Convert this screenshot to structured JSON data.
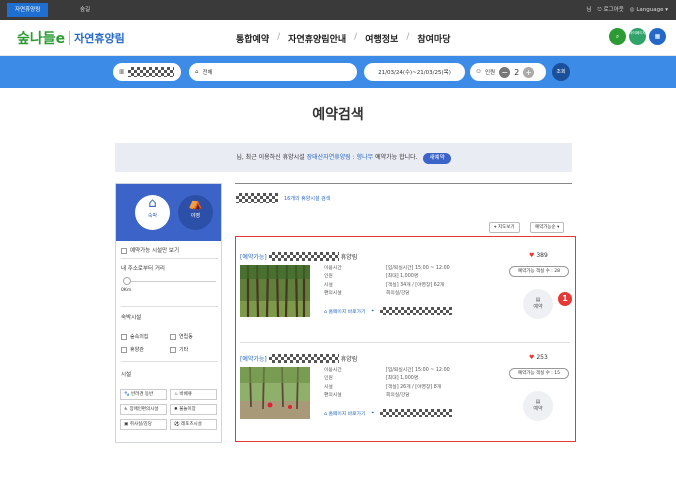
{
  "topbar": {
    "tab_active": "자연휴양림",
    "tab2": "숲길",
    "user": "님",
    "logout": "로그아웃",
    "language": "Language"
  },
  "header": {
    "brand_mark": "숲나들e",
    "brand_name": "자연휴양림",
    "nav": [
      "통합예약",
      "자연휴양림안내",
      "여행정보",
      "참여마당"
    ],
    "icon_labels": [
      "",
      "마이페이지",
      ""
    ]
  },
  "search": {
    "region": "전체",
    "dates": "21/03/24(수)~21/03/25(목)",
    "people_label": "인원",
    "people_count": "2",
    "go": "조회"
  },
  "page_title": "예약검색",
  "notice": {
    "prefix": "님, 최근 이용하신 휴양시설 ",
    "facility": "장태산자연휴양림 : 향나무",
    "suffix": " 예약가능 합니다.",
    "button": "새예약"
  },
  "left": {
    "type_lodging": "숙박",
    "type_camping": "야영",
    "only_available": "예약가능 시설만 보기",
    "distance_label": "내 주소로부터 거리",
    "distance_value": "0Km",
    "lodging_title": "숙박시설",
    "lodging_options": [
      "숲속의집",
      "연립동",
      "휴양관",
      "기타"
    ],
    "facility_title": "시설",
    "facility_options": [
      "반려견 동반",
      "바베큐",
      "장애인편의시설",
      "불놀이장",
      "취사실/강당",
      "레포츠시설"
    ]
  },
  "results": {
    "count_text": "16개의 휴양시설 검색",
    "map_button": "지도보기",
    "sort_button": "예약가능순"
  },
  "cards": [
    {
      "status": "[예약가능]",
      "suffix": "휴양림",
      "likes": "389",
      "avail": "예약가능 객실 수 : 28",
      "checkin_k": "이용시간",
      "checkin_v": "[입/퇴실시간] 15:00 ~ 12:00",
      "people_k": "인원",
      "people_v": "[최대] 1,000명",
      "fac_k": "시설",
      "fac_v": "[객실] 34개 / [야영장] 62개",
      "conv_k": "편의시설",
      "conv_v": "회의실/강당",
      "homepage": "홈페이지 바로가기",
      "reserve": "예약"
    },
    {
      "status": "[예약가능]",
      "suffix": "휴양림",
      "likes": "253",
      "avail": "예약가능 객실 수 : 15",
      "checkin_k": "이용시간",
      "checkin_v": "[입/퇴실시간] 15:00 ~ 12:00",
      "people_k": "인원",
      "people_v": "[최대] 1,000명",
      "fac_k": "시설",
      "fac_v": "[객실] 26개 / [야영장] 8개",
      "conv_k": "편의시설",
      "conv_v": "회의실/강당",
      "homepage": "홈페이지 바로가기",
      "reserve": "예약"
    }
  ],
  "annotation_badge": "1",
  "colors": {
    "primary": "#3c8ce7",
    "dark_blue": "#3c63c8",
    "green": "#2c9b34",
    "highlight": "#e53935"
  }
}
